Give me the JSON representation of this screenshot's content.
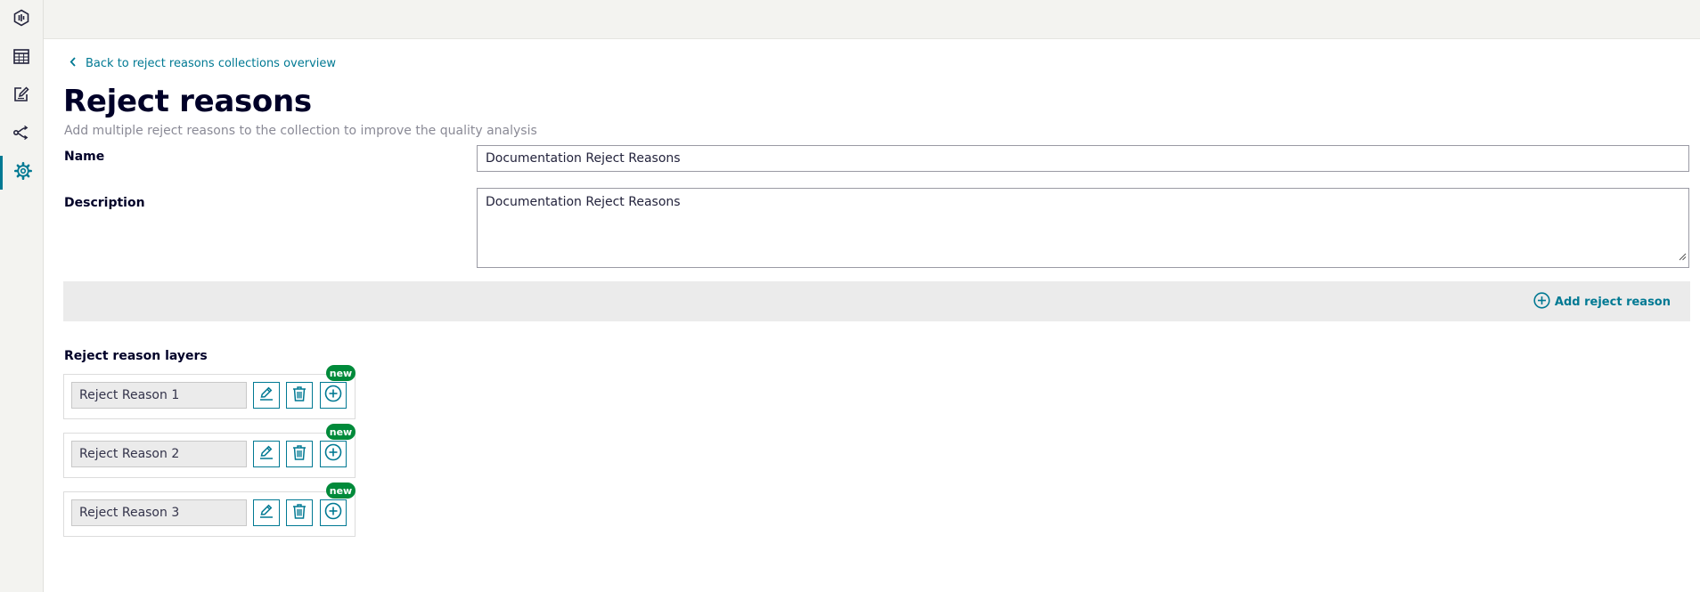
{
  "colors": {
    "accent": "#007993",
    "new_badge": "#008a3a",
    "sidebar_bg": "#f3f3f0"
  },
  "sidebar": {
    "items": [
      {
        "icon": "analytics-icon",
        "active": false
      },
      {
        "icon": "calendar-icon",
        "active": false
      },
      {
        "icon": "edit-note-icon",
        "active": false
      },
      {
        "icon": "flow-icon",
        "active": false
      },
      {
        "icon": "gear-icon",
        "active": true
      }
    ]
  },
  "header": {
    "back_link": "Back to reject reasons collections overview",
    "title": "Reject reasons",
    "subtitle": "Add multiple reject reasons to the collection to improve the quality analysis"
  },
  "form": {
    "name_label": "Name",
    "name_value": "Documentation Reject Reasons",
    "description_label": "Description",
    "description_value": "Documentation Reject Reasons"
  },
  "toolbar": {
    "add_label": "Add reject reason"
  },
  "layers": {
    "title": "Reject reason layers",
    "items": [
      {
        "name": "Reject Reason 1",
        "badge": "new"
      },
      {
        "name": "Reject Reason 2",
        "badge": "new"
      },
      {
        "name": "Reject Reason 3",
        "badge": "new"
      }
    ]
  }
}
